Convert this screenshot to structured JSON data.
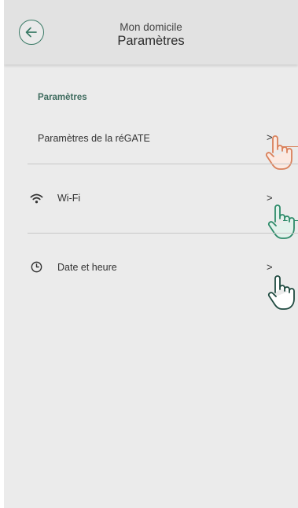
{
  "header": {
    "subtitle": "Mon domicile",
    "title": "Paramètres"
  },
  "section": {
    "label": "Paramètres"
  },
  "rows": [
    {
      "label": "Paramètres de la réGATE",
      "chevron": ">"
    },
    {
      "label": "Wi-Fi",
      "chevron": ">",
      "icon": "wifi-icon"
    },
    {
      "label": "Date et heure",
      "chevron": ">",
      "icon": "clock-icon"
    }
  ],
  "colors": {
    "accent": "#3a7a66",
    "header_bg": "#e2e2e2",
    "screen_bg": "#ebebeb",
    "hand_orange": "#d9805a",
    "hand_green": "#2e8b6a",
    "hand_dark": "#1f4a40"
  }
}
